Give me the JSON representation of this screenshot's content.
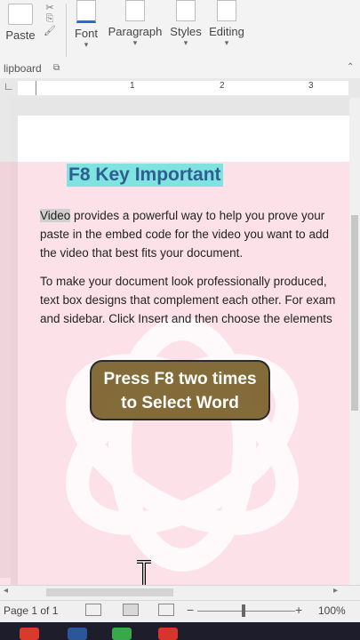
{
  "ribbon": {
    "groups": [
      {
        "label": "Paste"
      },
      {
        "label": "Font"
      },
      {
        "label": "Paragraph"
      },
      {
        "label": "Styles"
      },
      {
        "label": "Editing"
      }
    ],
    "clipboard_label": "lipboard"
  },
  "ruler": {
    "marks": [
      "1",
      "2",
      "3"
    ]
  },
  "document": {
    "heading": "F8 Key Important",
    "para1": {
      "selected_word": "Video",
      "line1_rest": " provides a powerful way to help you prove your",
      "line2": "paste in the embed code for the video you want to add",
      "line3": "the video that best fits your document."
    },
    "para2": {
      "line1": "To make your document look professionally produced,",
      "line2": "text box designs that complement each other. For exam",
      "line3": "and sidebar. Click Insert and then choose the elements"
    }
  },
  "caption": {
    "line1": "Press F8 two times",
    "line2": "to Select Word"
  },
  "status": {
    "page": "Page 1 of 1",
    "zoom": "100%"
  },
  "colors": {
    "accent_pink": "#f8bac8",
    "heading_highlight": "#7fe3e0",
    "heading_text": "#2f5f91",
    "caption_bg": "#786028"
  }
}
